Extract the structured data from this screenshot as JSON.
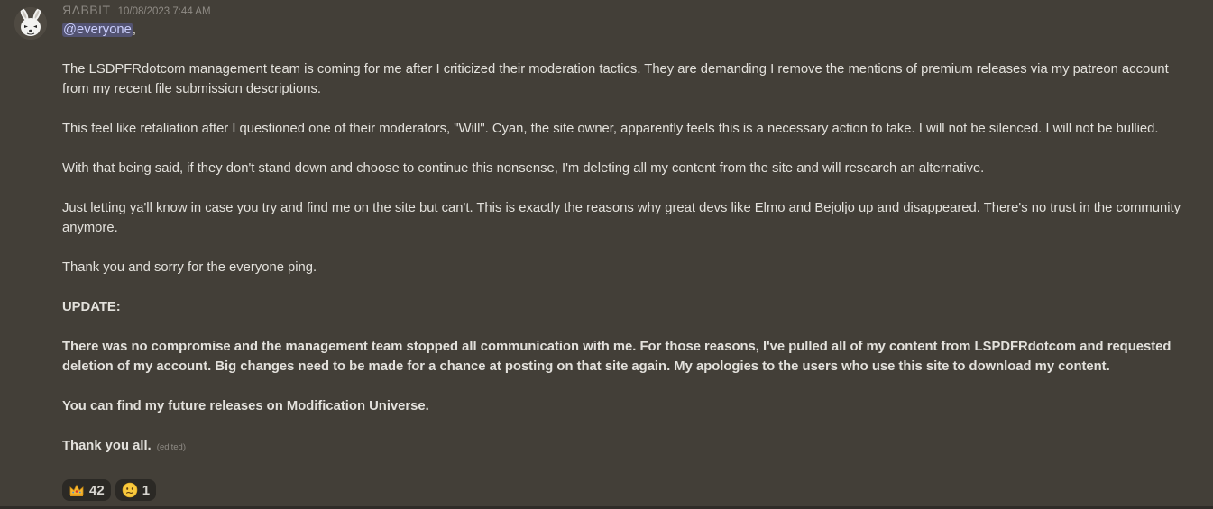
{
  "message": {
    "author": "ЯΛBBIT",
    "timestamp": "10/08/2023 7:44 AM",
    "mention": "@everyone",
    "mention_suffix": ",",
    "paragraphs": [
      "The LSDPFRdotcom management team is coming for me after I criticized their moderation tactics. They are demanding I remove the mentions of premium releases via my patreon account from my recent file submission descriptions.",
      "This feel like retaliation after I questioned one of their moderators, \"Will\". Cyan, the site owner, apparently feels this is a necessary action to take. I will not be silenced. I will not be bullied.",
      "With that being said, if they don't stand down and choose to continue this nonsense, I'm deleting all my content from the site and will research an alternative.",
      "Just letting ya'll know in case you try and find me on the site but can't. This is exactly the reasons why great devs like Elmo and Bejoljo up and disappeared. There's no trust in the community anymore.",
      "Thank you and sorry for the everyone ping."
    ],
    "update_heading": "UPDATE:",
    "update_paragraphs": [
      "There was no compromise and the management team stopped all communication with me. For  those reasons, I've pulled all of my content from LSPDFRdotcom and requested deletion of my account. Big changes need to be made for a chance at posting on that site again. My apologies to the users who use this site to download my content.",
      "You can find my future releases on Modification Universe."
    ],
    "closing": "Thank you all.",
    "edited_label": "(edited)"
  },
  "reactions": [
    {
      "emoji": "crown-emoji",
      "count": "42"
    },
    {
      "emoji": "grimace-face-emoji",
      "count": "1"
    }
  ],
  "colors": {
    "background": "#433f38",
    "text": "#e3e1dc",
    "mention_bg": "#5f62a0",
    "reaction_bg": "#2b2925"
  }
}
